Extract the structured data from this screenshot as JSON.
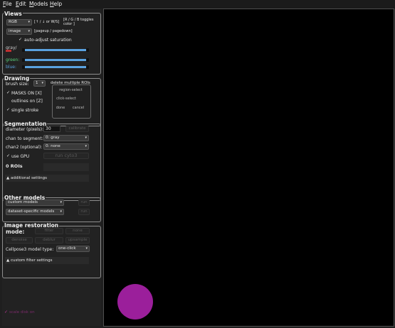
{
  "menu": {
    "file": "File",
    "edit": "Edit",
    "models": "Models",
    "help": "Help"
  },
  "views": {
    "title": "Views",
    "color_select": "RGB",
    "color_hint": "[↑ / ↓ or W/S]",
    "color_toggle_hint": "[R / G / B toggles color ]",
    "view_select": "image",
    "view_hint": "[pageup / pagedown]",
    "auto_adjust_label": "auto-adjust saturation",
    "gray_label": "gray/",
    "green_label": "green:",
    "blue_label": "blue:",
    "accent_gray": "#cfcfcf",
    "accent_green": "#58d27a",
    "accent_blue": "#5aa2e0"
  },
  "drawing": {
    "title": "Drawing",
    "brush_label": "brush size:",
    "brush_value": "1",
    "delete_label": "delete multiple ROIs",
    "region_select": "region-select",
    "click_select": "click-select",
    "done": "done",
    "cancel": "cancel",
    "masks_on": "MASKS ON [X]",
    "outlines_on": "outlines on [Z]",
    "single_stroke": "single stroke"
  },
  "segmentation": {
    "title": "Segmentation",
    "diameter_label": "diameter (pixels):",
    "diameter_value": "30",
    "calibrate": "calibrate",
    "chan_segment_label": "chan to segment:",
    "chan_segment_value": "0: gray",
    "chan2_label": "chan2 (optional):",
    "chan2_value": "0: none",
    "use_gpu": "use GPU",
    "run_cyto": "run cyto3",
    "roi_count": "0 ROIs",
    "additional_settings": "▲ additional settings"
  },
  "other_models": {
    "title": "Other models",
    "custom_models": "custom models",
    "custom_run": "run",
    "dataset_models": "dataset-specific models",
    "dataset_run": "run"
  },
  "restoration": {
    "title": "Image restoration",
    "mode_label": "mode:",
    "filter": "filter",
    "none": "none",
    "denoise": "denoise",
    "deblur": "deblur",
    "upsample": "upsample",
    "model_type_label": "Cellpose3 model type:",
    "model_type_value": "one-click",
    "custom_filter": "▲ custom filter settings"
  },
  "footer": {
    "scale_disk": "scale disk on"
  },
  "colors": {
    "scale_disk": "#9b1f9b"
  }
}
